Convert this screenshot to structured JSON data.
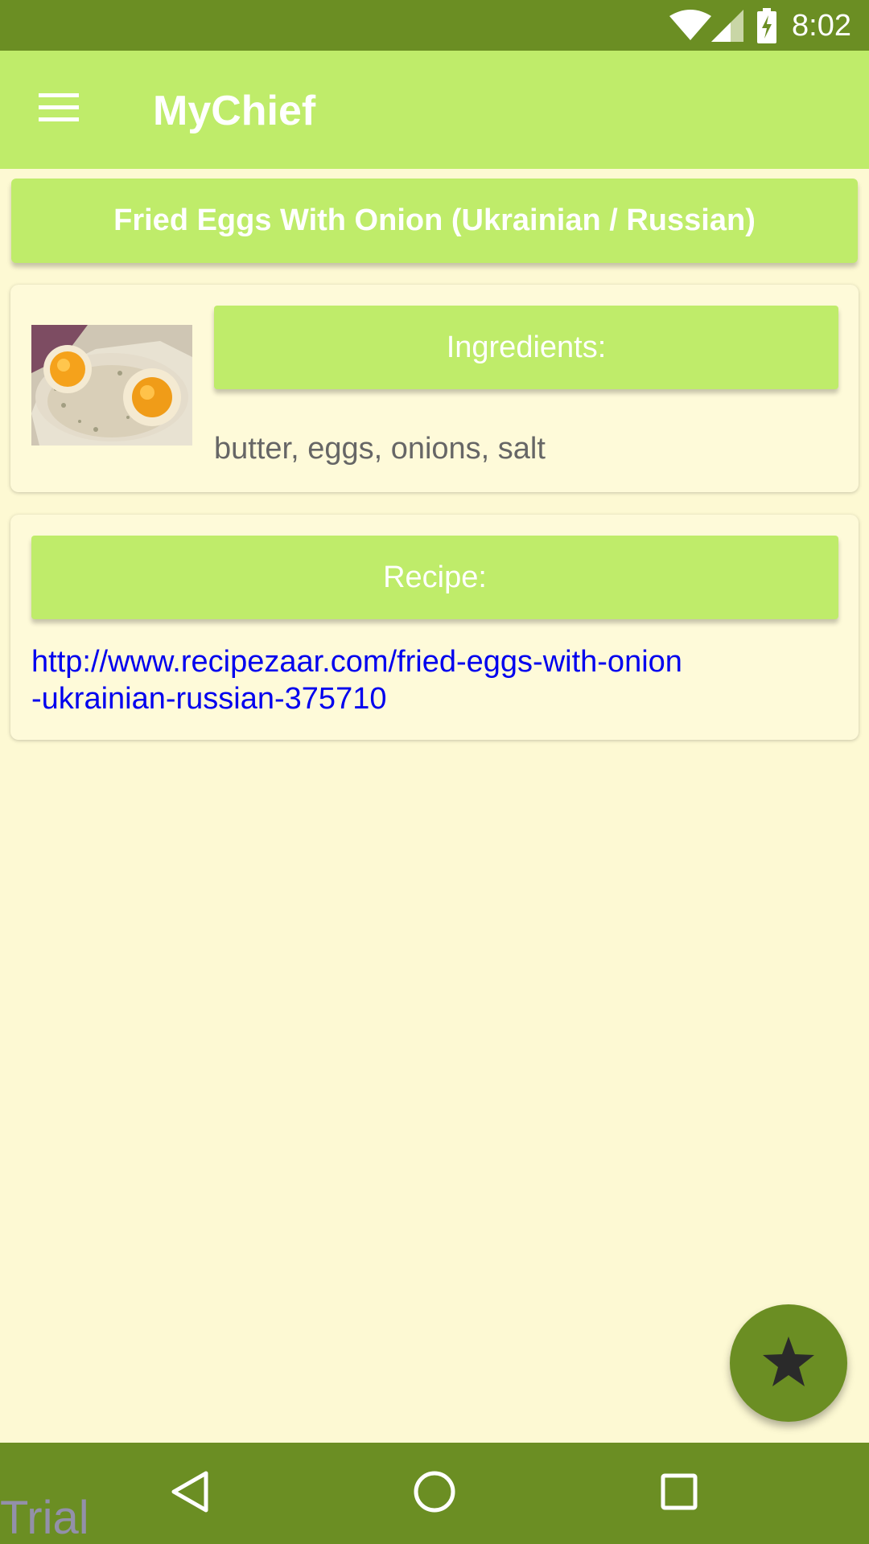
{
  "status_bar": {
    "time": "8:02",
    "icons": [
      "wifi-icon",
      "cell-signal-icon",
      "battery-charging-icon"
    ]
  },
  "app_bar": {
    "title": "MyChief",
    "menu_icon": "hamburger-menu-icon",
    "background_color": "#bfec6a"
  },
  "recipe": {
    "title": "Fried Eggs With Onion (Ukrainian / Russian)",
    "ingredients_header": "Ingredients:",
    "ingredients": "butter, eggs, onions, salt",
    "recipe_header": "Recipe:",
    "link_line1": "http://www.recipezaar.com/fried-eggs-with-onion",
    "link_line2": "-ukrainian-russian-375710"
  },
  "fab": {
    "icon": "star-icon",
    "color": "#6b8e23"
  },
  "nav_bar": {
    "icons": [
      "back-icon",
      "home-icon",
      "recents-icon"
    ],
    "watermark": "Trial"
  },
  "colors": {
    "status_bar": "#6b8e23",
    "accent": "#bfec6a",
    "background": "#fdf9d3",
    "link": "#0000ee"
  }
}
